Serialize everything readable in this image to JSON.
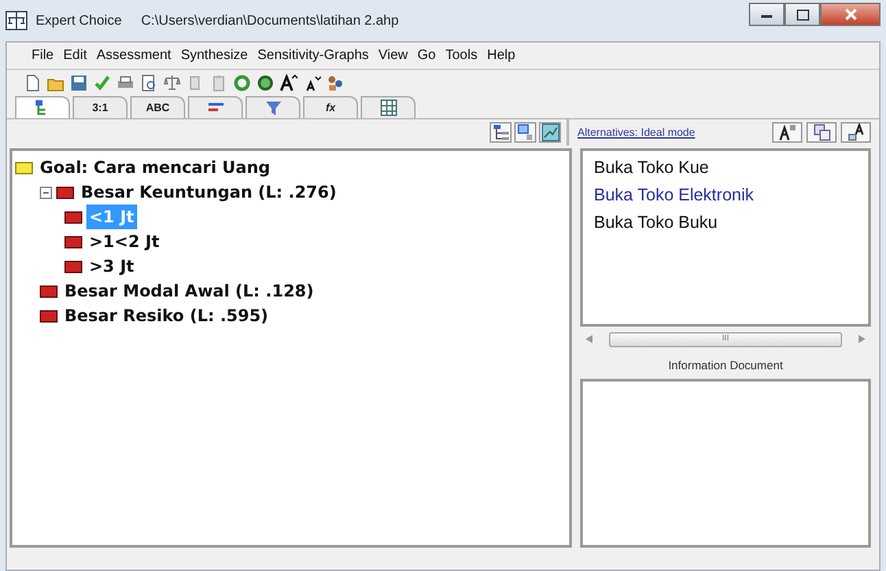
{
  "window": {
    "app": "Expert Choice",
    "path": "C:\\Users\\verdian\\Documents\\latihan 2.ahp"
  },
  "menu": [
    "File",
    "Edit",
    "Assessment",
    "Synthesize",
    "Sensitivity-Graphs",
    "View",
    "Go",
    "Tools",
    "Help"
  ],
  "view_tabs": [
    {
      "selected": true
    },
    {
      "label": "3:1",
      "selected": false
    },
    {
      "label": "ABC",
      "selected": false
    },
    {
      "selected": false
    },
    {
      "selected": false
    },
    {
      "label": "fx",
      "selected": false
    },
    {
      "selected": false
    }
  ],
  "tree": {
    "label": "Goal: Cara mencari Uang",
    "kind": "goal",
    "selected": false,
    "children": [
      {
        "label": "Besar Keuntungan (L: .276)",
        "kind": "criterion",
        "selected": false,
        "expanded": true,
        "children": [
          {
            "label": "<1 Jt",
            "kind": "criterion",
            "selected": true
          },
          {
            "label": ">1<2 Jt",
            "kind": "criterion",
            "selected": false
          },
          {
            "label": ">3 Jt",
            "kind": "criterion",
            "selected": false
          }
        ]
      },
      {
        "label": "Besar Modal Awal (L: .128)",
        "kind": "criterion",
        "selected": false
      },
      {
        "label": "Besar Resiko (L: .595)",
        "kind": "criterion",
        "selected": false
      }
    ]
  },
  "alternatives": {
    "mode_link": "Alternatives: Ideal mode",
    "items": [
      {
        "label": "Buka Toko Kue",
        "selected": false
      },
      {
        "label": "Buka Toko Elektronik",
        "selected": true
      },
      {
        "label": "Buka Toko Buku",
        "selected": false
      }
    ],
    "scroll_mark": "III"
  },
  "info_document": {
    "title": "Information Document"
  }
}
